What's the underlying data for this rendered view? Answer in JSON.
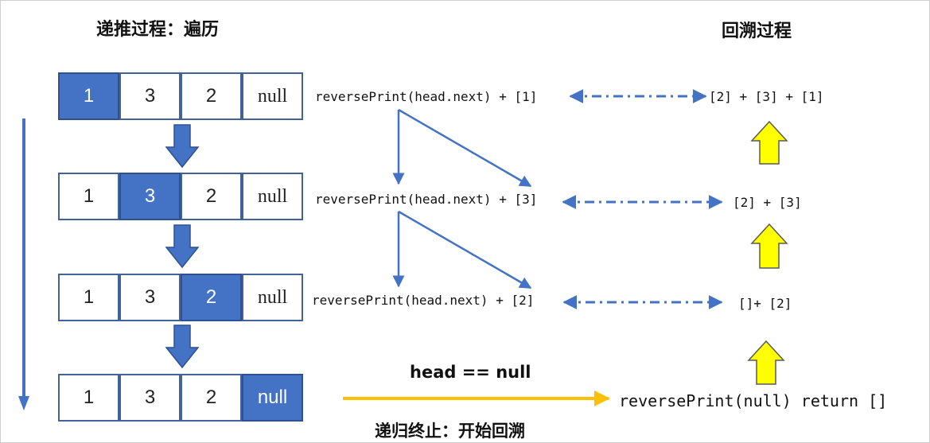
{
  "headings": {
    "left": "递推过程：遍历",
    "right": "回溯过程"
  },
  "rows": [
    {
      "cells": [
        "1",
        "3",
        "2",
        "null"
      ],
      "active": 0,
      "call": "reversePrint(head.next) + [1]",
      "result": "[2] + [3] + [1]"
    },
    {
      "cells": [
        "1",
        "3",
        "2",
        "null"
      ],
      "active": 1,
      "call": "reversePrint(head.next) + [3]",
      "result": "[2] + [3]"
    },
    {
      "cells": [
        "1",
        "3",
        "2",
        "null"
      ],
      "active": 2,
      "call": "reversePrint(head.next) + [2]",
      "result": "[]+ [2]"
    },
    {
      "cells": [
        "1",
        "3",
        "2",
        "null"
      ],
      "active": 3
    }
  ],
  "terminal": {
    "condition": "head == null",
    "caption": "递归终止：开始回溯",
    "call": "reversePrint(null) return []"
  },
  "colors": {
    "blue": "#4472c4",
    "yellow": "#ffff00",
    "orange": "#ffc000"
  }
}
